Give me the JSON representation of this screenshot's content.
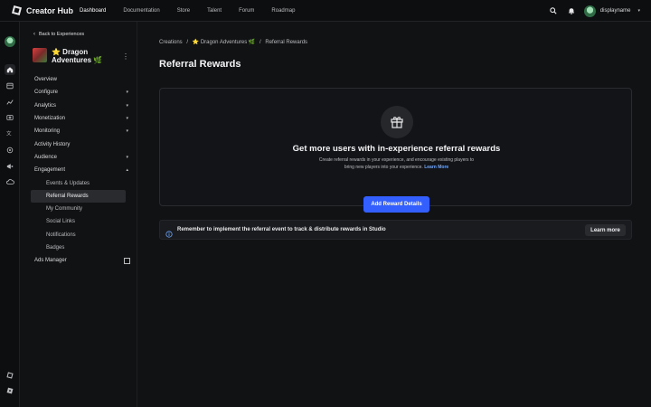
{
  "topbar": {
    "brand": "Creator Hub",
    "nav": [
      "Dashboard",
      "Documentation",
      "Store",
      "Talent",
      "Forum",
      "Roadmap"
    ],
    "active_nav": "Dashboard",
    "username": "displayname",
    "icons": [
      "search-icon",
      "bell-icon"
    ]
  },
  "rail": {
    "icons": [
      "home-icon",
      "creations-icon",
      "analytics-icon",
      "monetization-icon",
      "translate-icon",
      "settings-icon",
      "megaphone-icon",
      "cloud-icon",
      "roblox-studio-icon",
      "roblox-icon"
    ]
  },
  "sidebar": {
    "back_label": "Back to Experiences",
    "experience_title": "⭐ Dragon Adventures 🌿",
    "items": [
      {
        "label": "Overview",
        "expandable": false
      },
      {
        "label": "Configure",
        "expandable": true
      },
      {
        "label": "Analytics",
        "expandable": true
      },
      {
        "label": "Monetization",
        "expandable": true
      },
      {
        "label": "Monitoring",
        "expandable": true
      },
      {
        "label": "Activity History",
        "expandable": false
      },
      {
        "label": "Audience",
        "expandable": true
      },
      {
        "label": "Engagement",
        "expandable": true,
        "expanded": true
      }
    ],
    "engagement_items": [
      "Events & Updates",
      "Referral Rewards",
      "My Community",
      "Social Links",
      "Notifications",
      "Badges"
    ],
    "active_item": "Referral Rewards",
    "ads_manager": "Ads Manager"
  },
  "main": {
    "breadcrumbs": [
      "Creations",
      "/",
      "⭐ Dragon Adventures 🌿",
      "/",
      "Referral Rewards"
    ],
    "title": "Referral Rewards",
    "card": {
      "title": "Get more users with in-experience referral rewards",
      "description": "Create referral rewards in your experience, and encourage existing players to bring new players into your experience.",
      "learn_more": "Learn More",
      "button": "Add Reward Details"
    },
    "banner": {
      "text": "Remember to implement the referral event to track & distribute rewards in Studio",
      "button": "Learn more"
    }
  },
  "colors": {
    "accent": "#335fff",
    "link": "#6fa8ff",
    "background": "#111214"
  }
}
